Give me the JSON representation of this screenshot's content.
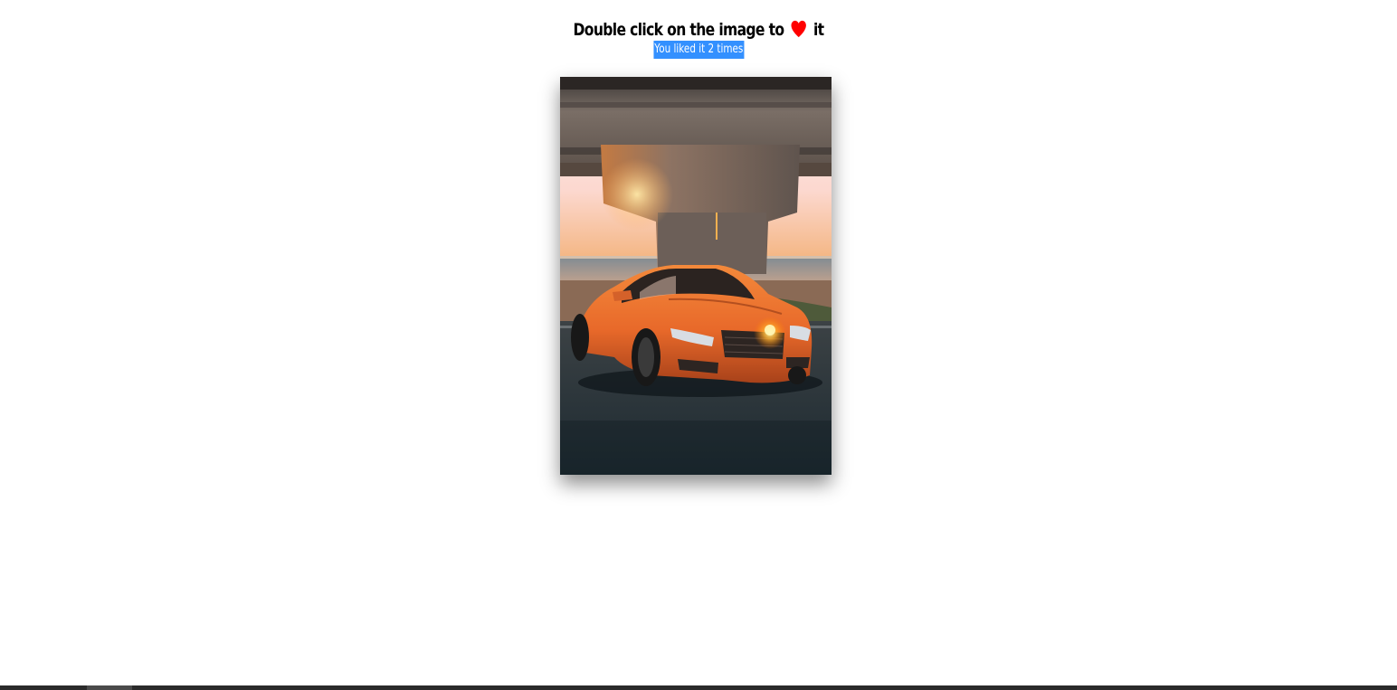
{
  "page": {
    "title_before": "Double click on the image to",
    "title_after": "it",
    "heart_icon": "heart-icon",
    "heart_color": "#ff0000",
    "likes_text": "You liked it 2 times",
    "likes_count": 2,
    "selection_color": "#3390ff"
  },
  "photo": {
    "subject": "orange car under bridge at sunset",
    "icon": "car-photo"
  }
}
